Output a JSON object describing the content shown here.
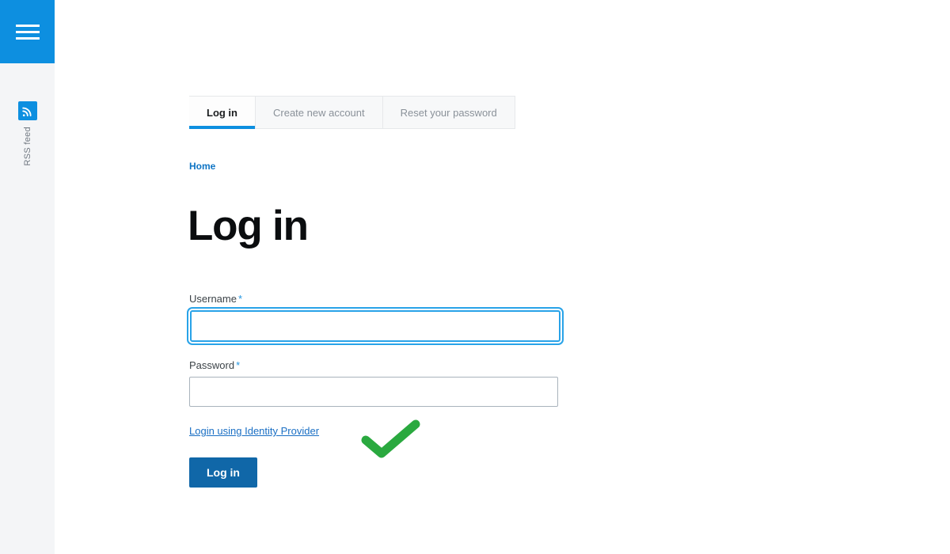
{
  "sidebar": {
    "menu_button_label": "Menu",
    "menu_icon": "hamburger-icon",
    "rss": {
      "icon": "rss-feed-icon",
      "label": "RSS feed"
    }
  },
  "tabs": [
    {
      "label": "Log in",
      "active": true
    },
    {
      "label": "Create new account",
      "active": false
    },
    {
      "label": "Reset your password",
      "active": false
    }
  ],
  "breadcrumb": {
    "home_label": "Home"
  },
  "page": {
    "title": "Log in"
  },
  "form": {
    "username": {
      "label": "Username",
      "required_mark": "*",
      "value": "",
      "placeholder": "",
      "focused": true
    },
    "password": {
      "label": "Password",
      "required_mark": "*",
      "value": "",
      "placeholder": "",
      "focused": false
    },
    "idp_link_label": "Login using Identity Provider",
    "submit_label": "Log in"
  },
  "annotation": {
    "type": "checkmark",
    "color": "#2aa93f"
  },
  "colors": {
    "brand_blue": "#0d8fe0",
    "button_blue": "#1067a8",
    "link_blue": "#1a6fc4",
    "breadcrumb_blue": "#0e74c4",
    "focus_blue": "#29a3e8",
    "rail_gray": "#f4f5f7",
    "tab_inactive_bg": "#f7f8f9",
    "tab_border": "#e6e8ea",
    "check_green": "#2aa93f"
  }
}
